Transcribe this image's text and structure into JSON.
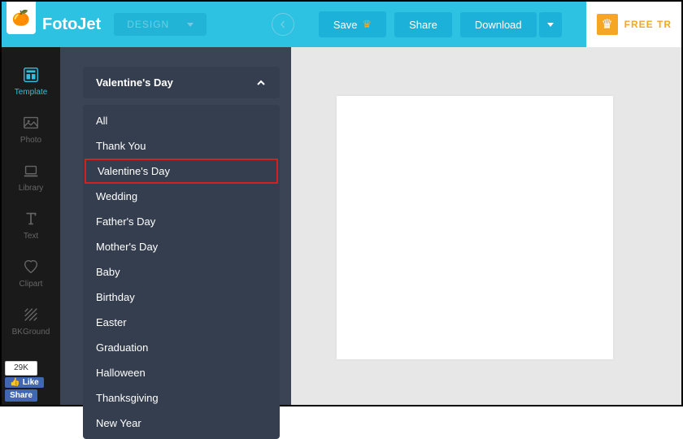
{
  "brand": "FotoJet",
  "design_label": "DESIGN",
  "topbar": {
    "save": "Save",
    "share": "Share",
    "download": "Download",
    "free_trial": "FREE TR"
  },
  "sidebar": {
    "items": [
      {
        "label": "Template"
      },
      {
        "label": "Photo"
      },
      {
        "label": "Library"
      },
      {
        "label": "Text"
      },
      {
        "label": "Clipart"
      },
      {
        "label": "BKGround"
      }
    ]
  },
  "social": {
    "count": "29K",
    "like": "Like",
    "share": "Share"
  },
  "dropdown": {
    "selected": "Valentine's Day",
    "items": [
      "All",
      "Thank You",
      "Valentine's Day",
      "Wedding",
      "Father's Day",
      "Mother's Day",
      "Baby",
      "Birthday",
      "Easter",
      "Graduation",
      "Halloween",
      "Thanksgiving",
      "New Year"
    ],
    "highlighted_index": 2
  }
}
